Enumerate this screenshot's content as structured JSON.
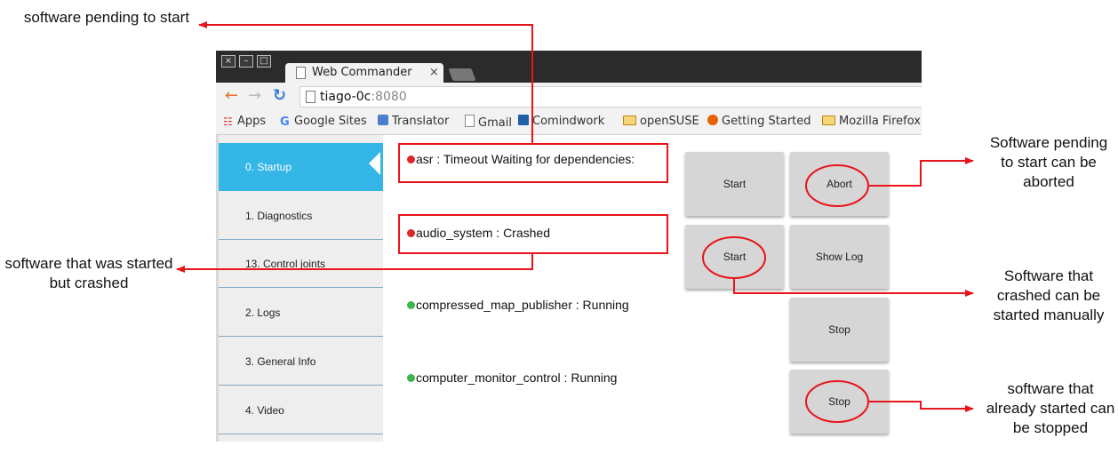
{
  "annotations": {
    "pending": "software pending to start",
    "crashed": "software that was started but crashed",
    "abort": "Software pending to start can be aborted",
    "start_manual": "Software that crashed can be started manually",
    "stop": "software that already started can be stopped"
  },
  "window": {
    "controls": [
      "×",
      "–",
      "□"
    ],
    "tab_title": "Web Commander",
    "tab_close": "×"
  },
  "address_bar": {
    "back_icon": "back-arrow-icon",
    "forward_icon": "forward-arrow-icon",
    "reload_icon": "reload-icon",
    "host": "tiago-0c",
    "port": ":8080"
  },
  "bookmarks": [
    {
      "label": "Apps",
      "icon": "apps-icon"
    },
    {
      "label": "Google Sites",
      "icon": "google-icon"
    },
    {
      "label": "Translator",
      "icon": "translator-icon"
    },
    {
      "label": "Gmail",
      "icon": "page-icon"
    },
    {
      "label": "Comindwork",
      "icon": "comindwork-icon"
    },
    {
      "label": "openSUSE",
      "icon": "folder-icon"
    },
    {
      "label": "Getting Started",
      "icon": "firefox-icon"
    },
    {
      "label": "Mozilla Firefox",
      "icon": "folder-icon"
    }
  ],
  "sidebar": {
    "items": [
      {
        "label": "0. Startup",
        "active": true
      },
      {
        "label": "1. Diagnostics",
        "active": false
      },
      {
        "label": "13. Control joints",
        "active": false
      },
      {
        "label": "2. Logs",
        "active": false
      },
      {
        "label": "3. General Info",
        "active": false
      },
      {
        "label": "4. Video",
        "active": false
      }
    ]
  },
  "services": [
    {
      "name": "asr",
      "status": "Timeout Waiting for dependencies:",
      "color": "#e0262a"
    },
    {
      "name": "audio_system",
      "status": "Crashed",
      "color": "#e0262a"
    },
    {
      "name": "compressed_map_publisher",
      "status": "Running",
      "color": "#3cb54a"
    },
    {
      "name": "computer_monitor_control",
      "status": "Running",
      "color": "#3cb54a"
    }
  ],
  "buttons": {
    "asr_start": "Start",
    "asr_abort": "Abort",
    "audio_start": "Start",
    "audio_show_log": "Show Log",
    "map_stop": "Stop",
    "monitor_stop": "Stop"
  },
  "colors": {
    "annotation_red": "#e8141b",
    "sidebar_active": "#34b6e6",
    "running": "#3cb54a",
    "error": "#e0262a"
  }
}
